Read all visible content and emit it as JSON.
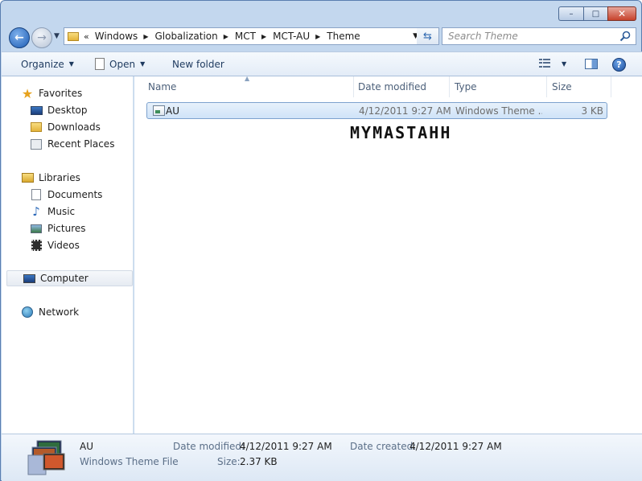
{
  "window": {
    "caption": {
      "min": "–",
      "max": "□",
      "close": "✕"
    }
  },
  "nav": {
    "chevrons": "«",
    "breadcrumb": [
      "Windows",
      "Globalization",
      "MCT",
      "MCT-AU",
      "Theme"
    ],
    "search_placeholder": "Search Theme"
  },
  "toolbar": {
    "organize": "Organize",
    "open": "Open",
    "new_folder": "New folder",
    "help": "?"
  },
  "sidebar": {
    "favorites": "Favorites",
    "desktop": "Desktop",
    "downloads": "Downloads",
    "recent": "Recent Places",
    "libraries": "Libraries",
    "documents": "Documents",
    "music": "Music",
    "pictures": "Pictures",
    "videos": "Videos",
    "computer": "Computer",
    "network": "Network"
  },
  "columns": {
    "name": "Name",
    "date": "Date modified",
    "type": "Type",
    "size": "Size"
  },
  "file": {
    "name": "AU",
    "date": "4/12/2011 9:27 AM",
    "type": "Windows Theme ...",
    "size": "3 KB"
  },
  "watermark": "MYMASTAHH",
  "details": {
    "name": "AU",
    "kind": "Windows Theme File",
    "modified_label": "Date modified:",
    "modified_value": "4/12/2011 9:27 AM",
    "created_label": "Date created:",
    "created_value": "4/12/2011 9:27 AM",
    "size_label": "Size:",
    "size_value": "2.37 KB"
  },
  "colors": {
    "accent": "#1b5bb4",
    "selection": "#cfe3f8",
    "chrome": "#c3d7ee"
  }
}
